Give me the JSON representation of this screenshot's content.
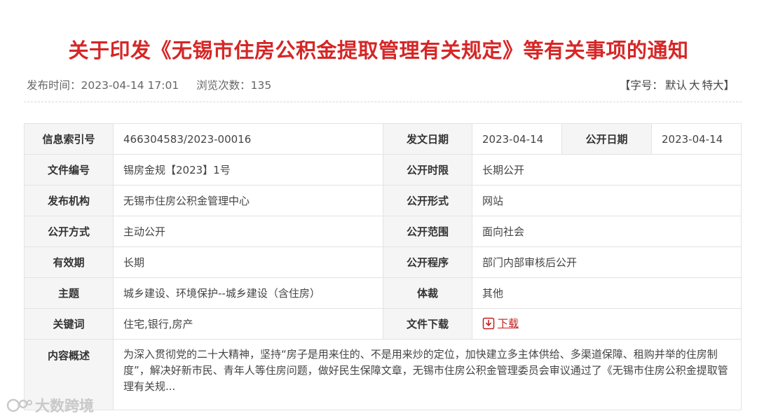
{
  "article": {
    "title": "关于印发《无锡市住房公积金提取管理有关规定》等有关事项的通知",
    "publish_time": "发布时间：2023-04-14 17:01",
    "views": "浏览次数：135",
    "font_size": {
      "open": "【字号：",
      "default": "默认",
      "large": "大",
      "xlarge": "特大",
      "close": "】"
    }
  },
  "info": {
    "rows": [
      {
        "k1": "信息索引号",
        "v1": "466304583/2023-00016",
        "k2": "发文日期",
        "v2": "2023-04-14",
        "k3": "公开日期",
        "v3": "2023-04-14"
      },
      {
        "k1": "文件编号",
        "v1": "锡房金规【2023】1号",
        "k2": "公开时限",
        "v2": "长期公开"
      },
      {
        "k1": "发布机构",
        "v1": "无锡市住房公积金管理中心",
        "k2": "公开形式",
        "v2": "网站"
      },
      {
        "k1": "公开方式",
        "v1": "主动公开",
        "k2": "公开范围",
        "v2": "面向社会"
      },
      {
        "k1": "有效期",
        "v1": "长期",
        "k2": "公开程序",
        "v2": "部门内部审核后公开"
      },
      {
        "k1": "主题",
        "v1": "城乡建设、环境保护--城乡建设（含住房）",
        "k2": "体裁",
        "v2": "其他"
      },
      {
        "k1": "关键词",
        "v1": "住宅,银行,房产",
        "k2": "文件下载",
        "v2": "下载"
      }
    ],
    "summary_label": "内容概述",
    "summary": "为深入贯彻党的二十大精神，坚持“房子是用来住的、不是用来炒的定位，加快建立多主体供给、多渠道保障、租购并举的住房制度”，解决好新市民、青年人等住房问题，做好民生保障文章，无锡市住房公积金管理委员会审议通过了《无锡市住房公积金提取管理有关规..."
  },
  "watermark": "大数跨境",
  "colors": {
    "title": "#d62626",
    "download": "#c51d1d",
    "label_bg": "#f5f5f5"
  },
  "icons": {
    "download": "download-icon",
    "watermark": "watermark-logo-icon"
  }
}
